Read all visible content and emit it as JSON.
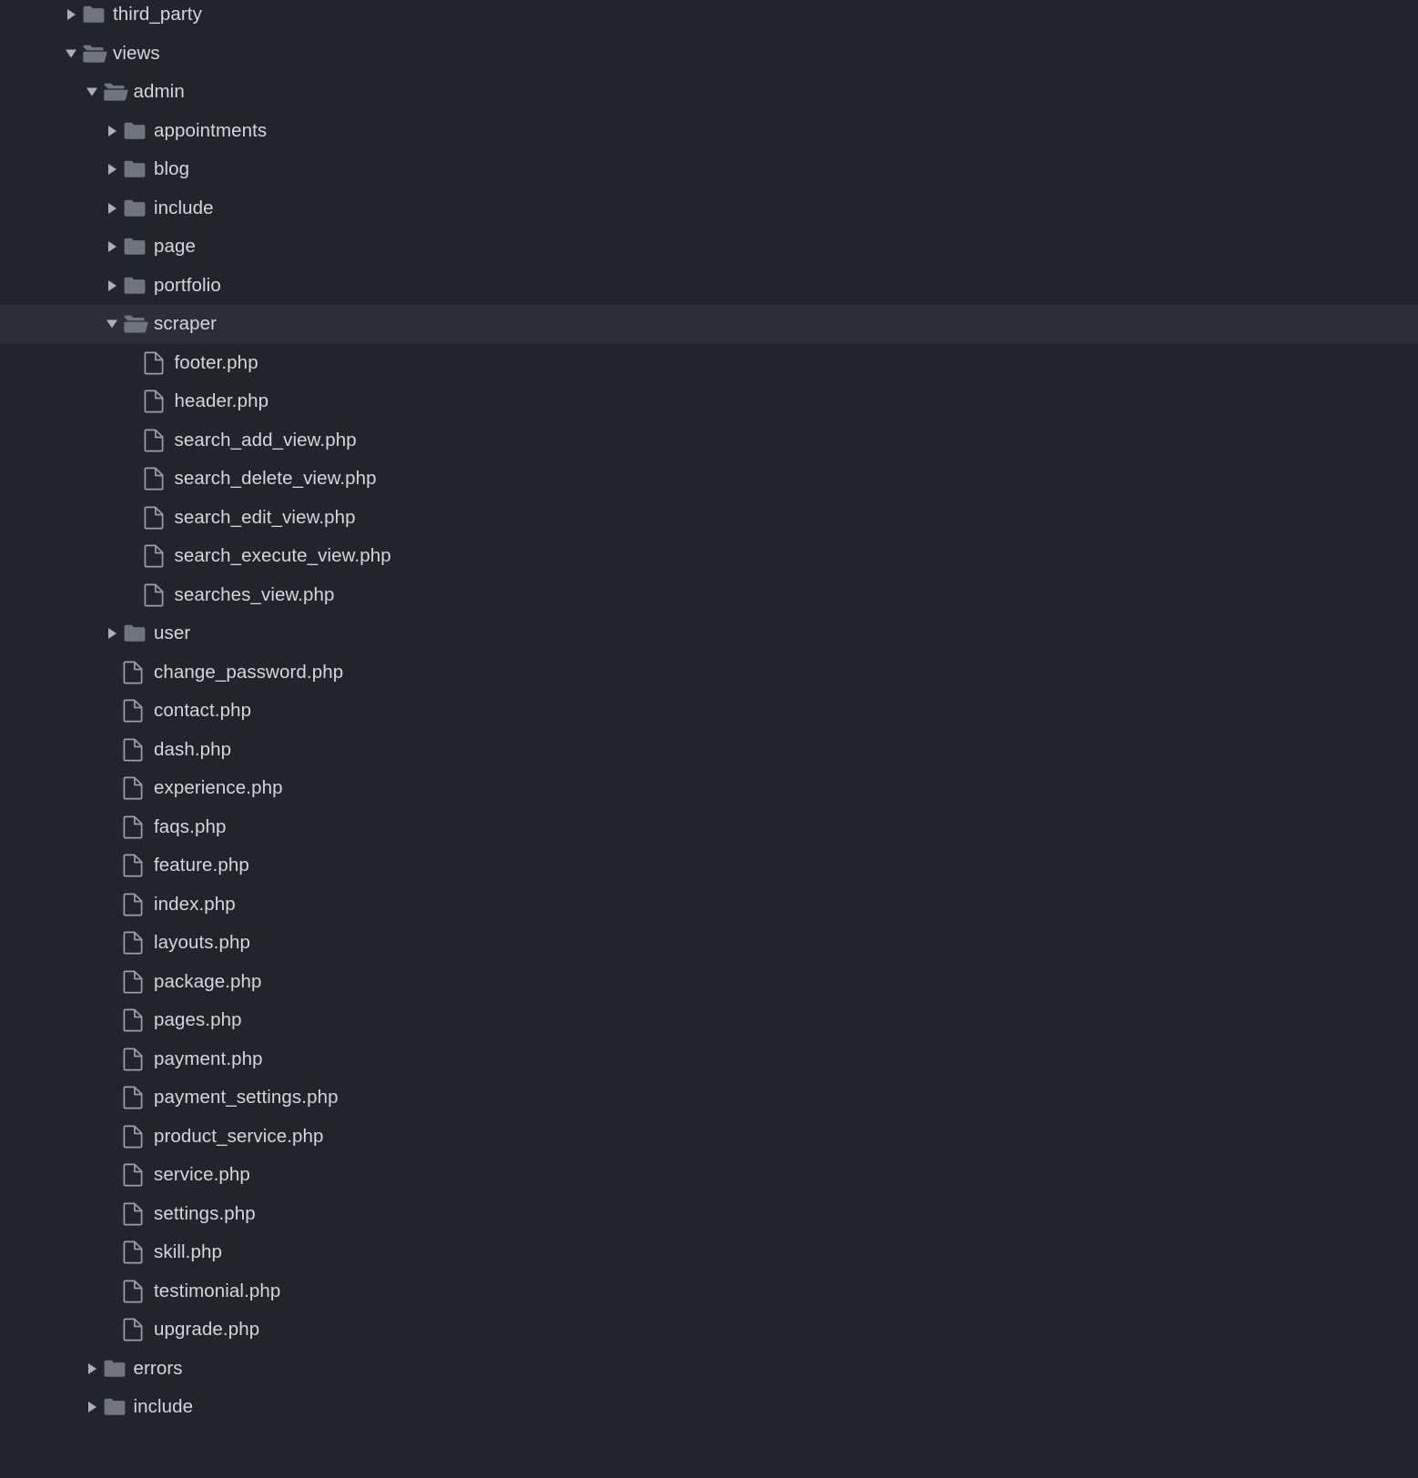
{
  "theme": {
    "background": "#212429",
    "row_selected_background": "#2b2f35",
    "text_color": "#d3d6da",
    "folder_color": "#6e757d",
    "file_stroke_color": "#9aa0a6",
    "twisty_color": "#aab0b6"
  },
  "tree": {
    "name": "project-file-tree",
    "rows": [
      {
        "label": "third_party",
        "type": "folder",
        "state": "collapsed",
        "depth": 0,
        "selected": false
      },
      {
        "label": "views",
        "type": "folder",
        "state": "expanded",
        "depth": 0,
        "selected": false
      },
      {
        "label": "admin",
        "type": "folder",
        "state": "expanded",
        "depth": 1,
        "selected": false
      },
      {
        "label": "appointments",
        "type": "folder",
        "state": "collapsed",
        "depth": 2,
        "selected": false
      },
      {
        "label": "blog",
        "type": "folder",
        "state": "collapsed",
        "depth": 2,
        "selected": false
      },
      {
        "label": "include",
        "type": "folder",
        "state": "collapsed",
        "depth": 2,
        "selected": false
      },
      {
        "label": "page",
        "type": "folder",
        "state": "collapsed",
        "depth": 2,
        "selected": false
      },
      {
        "label": "portfolio",
        "type": "folder",
        "state": "collapsed",
        "depth": 2,
        "selected": false
      },
      {
        "label": "scraper",
        "type": "folder",
        "state": "expanded",
        "depth": 2,
        "selected": true
      },
      {
        "label": "footer.php",
        "type": "file",
        "state": "none",
        "depth": 3,
        "selected": false
      },
      {
        "label": "header.php",
        "type": "file",
        "state": "none",
        "depth": 3,
        "selected": false
      },
      {
        "label": "search_add_view.php",
        "type": "file",
        "state": "none",
        "depth": 3,
        "selected": false
      },
      {
        "label": "search_delete_view.php",
        "type": "file",
        "state": "none",
        "depth": 3,
        "selected": false
      },
      {
        "label": "search_edit_view.php",
        "type": "file",
        "state": "none",
        "depth": 3,
        "selected": false
      },
      {
        "label": "search_execute_view.php",
        "type": "file",
        "state": "none",
        "depth": 3,
        "selected": false
      },
      {
        "label": "searches_view.php",
        "type": "file",
        "state": "none",
        "depth": 3,
        "selected": false
      },
      {
        "label": "user",
        "type": "folder",
        "state": "collapsed",
        "depth": 2,
        "selected": false
      },
      {
        "label": "change_password.php",
        "type": "file",
        "state": "none",
        "depth": 2,
        "selected": false
      },
      {
        "label": "contact.php",
        "type": "file",
        "state": "none",
        "depth": 2,
        "selected": false
      },
      {
        "label": "dash.php",
        "type": "file",
        "state": "none",
        "depth": 2,
        "selected": false
      },
      {
        "label": "experience.php",
        "type": "file",
        "state": "none",
        "depth": 2,
        "selected": false
      },
      {
        "label": "faqs.php",
        "type": "file",
        "state": "none",
        "depth": 2,
        "selected": false
      },
      {
        "label": "feature.php",
        "type": "file",
        "state": "none",
        "depth": 2,
        "selected": false
      },
      {
        "label": "index.php",
        "type": "file",
        "state": "none",
        "depth": 2,
        "selected": false
      },
      {
        "label": "layouts.php",
        "type": "file",
        "state": "none",
        "depth": 2,
        "selected": false
      },
      {
        "label": "package.php",
        "type": "file",
        "state": "none",
        "depth": 2,
        "selected": false
      },
      {
        "label": "pages.php",
        "type": "file",
        "state": "none",
        "depth": 2,
        "selected": false
      },
      {
        "label": "payment.php",
        "type": "file",
        "state": "none",
        "depth": 2,
        "selected": false
      },
      {
        "label": "payment_settings.php",
        "type": "file",
        "state": "none",
        "depth": 2,
        "selected": false
      },
      {
        "label": "product_service.php",
        "type": "file",
        "state": "none",
        "depth": 2,
        "selected": false
      },
      {
        "label": "service.php",
        "type": "file",
        "state": "none",
        "depth": 2,
        "selected": false
      },
      {
        "label": "settings.php",
        "type": "file",
        "state": "none",
        "depth": 2,
        "selected": false
      },
      {
        "label": "skill.php",
        "type": "file",
        "state": "none",
        "depth": 2,
        "selected": false
      },
      {
        "label": "testimonial.php",
        "type": "file",
        "state": "none",
        "depth": 2,
        "selected": false
      },
      {
        "label": "upgrade.php",
        "type": "file",
        "state": "none",
        "depth": 2,
        "selected": false
      },
      {
        "label": "errors",
        "type": "folder",
        "state": "collapsed",
        "depth": 1,
        "selected": false
      },
      {
        "label": "include",
        "type": "folder",
        "state": "collapsed",
        "depth": 1,
        "selected": false
      }
    ]
  }
}
